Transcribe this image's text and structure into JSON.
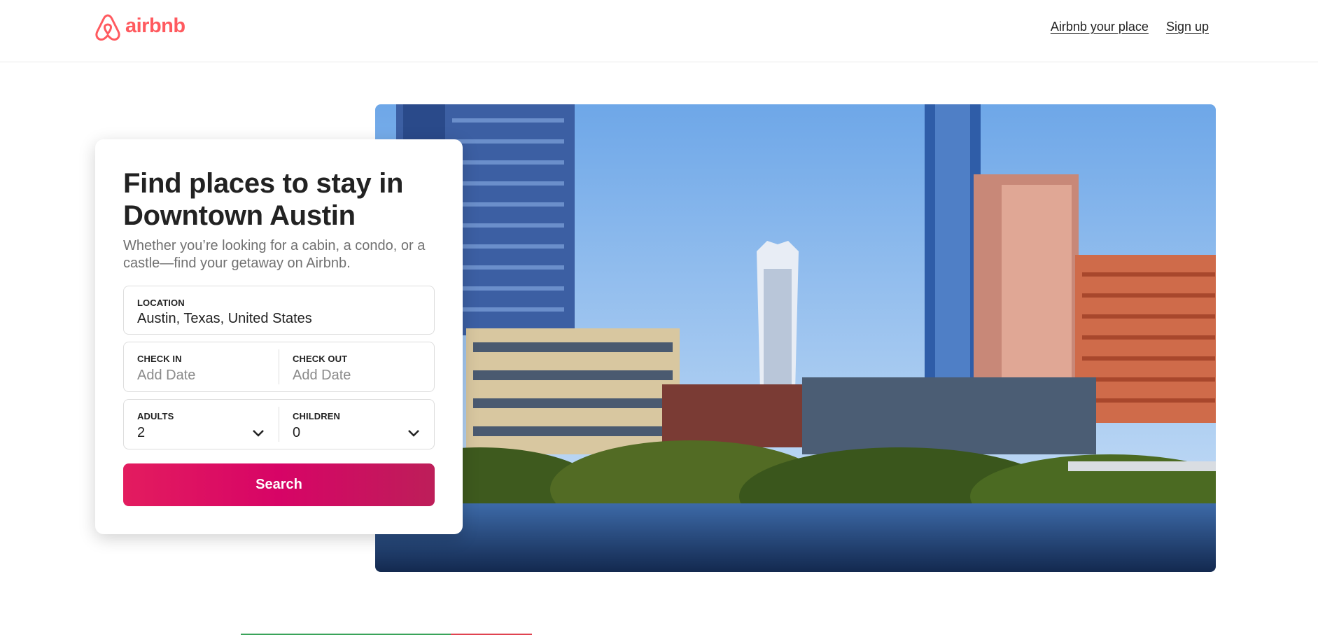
{
  "brand": {
    "name": "airbnb",
    "color": "#ff5a5f",
    "logo_icon": "airbnb-belo-icon"
  },
  "nav": {
    "host_link": "Airbnb your place",
    "signup_link": "Sign up"
  },
  "hero": {
    "title": "Find places to stay in Downtown Austin",
    "subtitle": "Whether you’re looking for a cabin, a condo, or a castle—find your getaway on Airbnb.",
    "image_subject": "downtown-austin-skyline-photo"
  },
  "form": {
    "location": {
      "label": "LOCATION",
      "value": "Austin, Texas, United States"
    },
    "check_in": {
      "label": "CHECK IN",
      "placeholder": "Add Date"
    },
    "check_out": {
      "label": "CHECK OUT",
      "placeholder": "Add Date"
    },
    "adults": {
      "label": "ADULTS",
      "value": "2"
    },
    "children": {
      "label": "CHILDREN",
      "value": "0"
    },
    "search_label": "Search"
  },
  "colors": {
    "accent_start": "#e31c5f",
    "accent_end": "#bd1e59",
    "text": "#222222",
    "muted": "#717171"
  }
}
